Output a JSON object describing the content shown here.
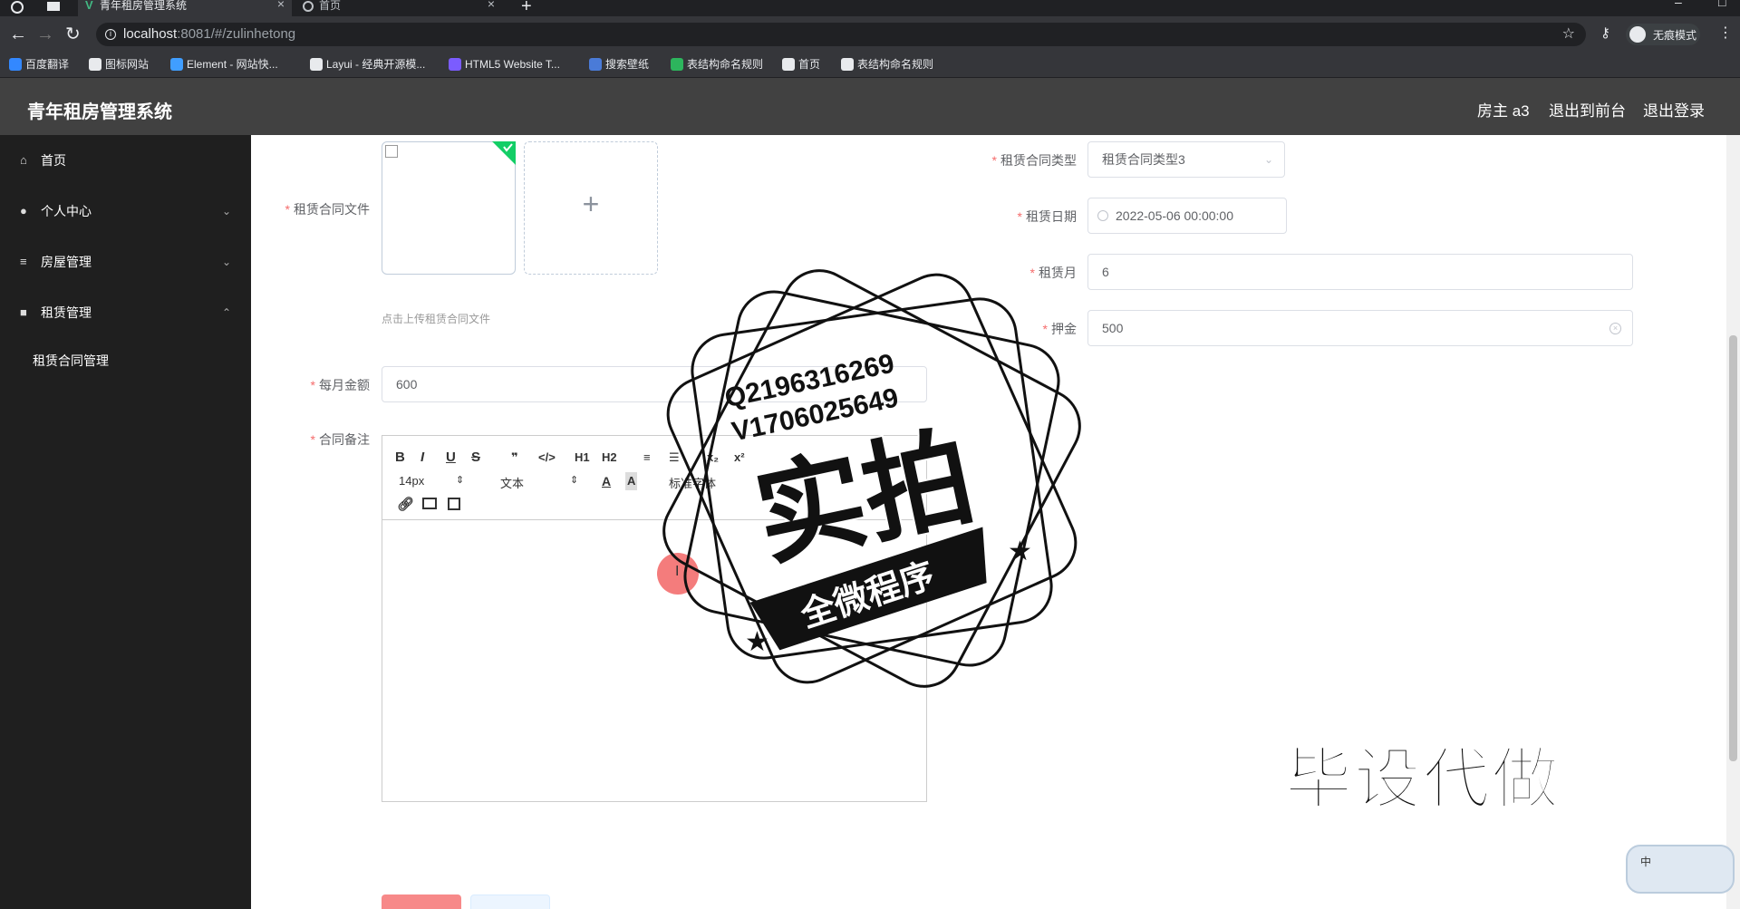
{
  "browser": {
    "tabs": [
      {
        "label": "青年租房管理系统",
        "active": true
      },
      {
        "label": "首页",
        "active": false
      }
    ],
    "url_host": "localhost",
    "url_path": ":8081/#/zulinhetong",
    "profile_label": "无痕模式",
    "bookmarks": [
      {
        "label": "百度翻译",
        "icon": "translate-icon",
        "color": "#3388ff"
      },
      {
        "label": "图标网站",
        "icon": "flag-icon",
        "color": "#e8eaed"
      },
      {
        "label": "Element - 网站快...",
        "icon": "element-icon",
        "color": "#409eff"
      },
      {
        "label": "Layui - 经典开源模...",
        "icon": "layui-icon",
        "color": "#e8eaed"
      },
      {
        "label": "HTML5 Website T...",
        "icon": "html5-icon",
        "color": "#7b5cff"
      },
      {
        "label": "搜索壁纸",
        "icon": "wallpaper-icon",
        "color": "#4a7bd8"
      },
      {
        "label": "表结构命名规则",
        "icon": "sheet-icon",
        "color": "#2db55d"
      },
      {
        "label": "首页",
        "icon": "globe-icon",
        "color": "#e8eaed"
      },
      {
        "label": "表结构命名规则",
        "icon": "globe-icon",
        "color": "#e8eaed"
      }
    ]
  },
  "header": {
    "title": "青年租房管理系统",
    "user_label": "房主 a3",
    "front_label": "退出到前台",
    "logout_label": "退出登录",
    "bg_color": "#414141"
  },
  "sidebar": {
    "items": [
      {
        "label": "首页",
        "icon": "home-icon",
        "expandable": false
      },
      {
        "label": "个人中心",
        "icon": "user-icon",
        "expandable": true,
        "expanded": false
      },
      {
        "label": "房屋管理",
        "icon": "sliders-icon",
        "expandable": true,
        "expanded": false
      },
      {
        "label": "租赁管理",
        "icon": "briefcase-icon",
        "expandable": true,
        "expanded": true
      }
    ],
    "subitems": [
      {
        "label": "租赁合同管理"
      }
    ]
  },
  "form": {
    "contract_file_label": "租赁合同文件",
    "upload_hint": "点击上传租赁合同文件",
    "monthly_label": "每月金额",
    "monthly_value": "600",
    "remark_label": "合同备注",
    "type_label": "租赁合同类型",
    "type_value": "租赁合同类型3",
    "date_label": "租赁日期",
    "date_value": "2022-05-06 00:00:00",
    "months_label": "租赁月",
    "months_value": "6",
    "deposit_label": "押金",
    "deposit_value": "500",
    "required_mark": "*"
  },
  "editor": {
    "row1": [
      "B",
      "I",
      "U",
      "S",
      "❞",
      "</>",
      "H1",
      "H2",
      "≡",
      "☰",
      "x₂",
      "x²"
    ],
    "font_size": "14px",
    "text_type": "文本",
    "font_family": "标准字体"
  },
  "watermark": {
    "qq": "Q2196316269",
    "vx": "V1706025649",
    "big": "实拍",
    "ribbon": "全微程序",
    "corner": "毕设代做"
  },
  "ime": {
    "label": "中"
  }
}
